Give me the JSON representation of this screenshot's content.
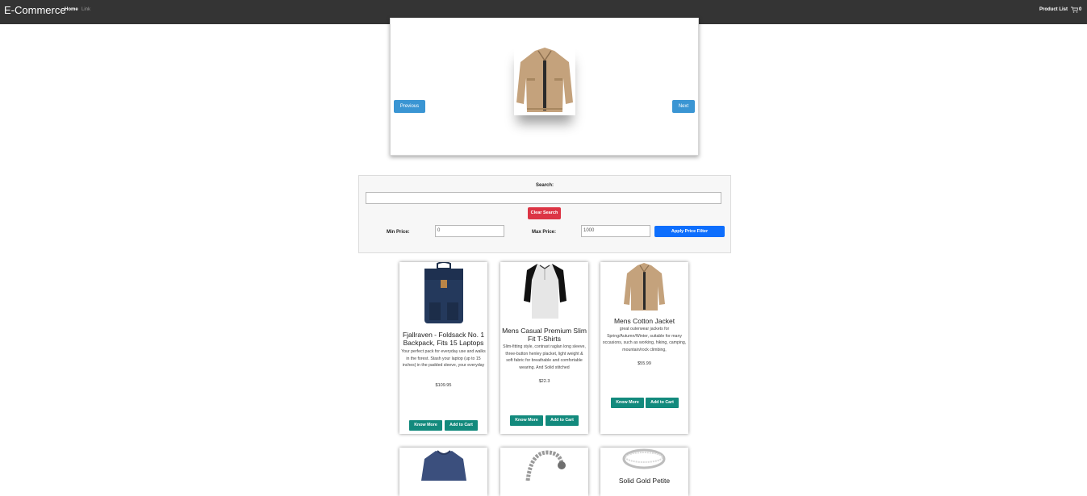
{
  "navbar": {
    "brand": "E-Commerce",
    "home": "Home",
    "link": "Link",
    "product_list": "Product List",
    "cart_count": "0"
  },
  "carousel": {
    "previous": "Previous",
    "next": "Next"
  },
  "filter": {
    "search_label": "Search:",
    "search_value": "",
    "clear_label": "Clear Search",
    "min_label": "Min Price:",
    "min_value": "0",
    "max_label": "Max Price:",
    "max_value": "1000",
    "apply_label": "Apply Price Filter"
  },
  "products": [
    {
      "title": "Fjallraven - Foldsack No. 1 Backpack, Fits 15 Laptops",
      "description": "Your perfect pack for everyday use and walks in the forest. Stash your laptop (up to 15 inches) in the padded sleeve, your everyday",
      "price": "$109.95",
      "know_more": "Know More",
      "add_to_cart": "Add to Cart"
    },
    {
      "title": "Mens Casual Premium Slim Fit T-Shirts",
      "description": "Slim-fitting style, contrast raglan long sleeve, three-button henley placket, light weight & soft fabric for breathable and comfortable wearing. And Solid stitched",
      "price": "$22.3",
      "know_more": "Know More",
      "add_to_cart": "Add to Cart"
    },
    {
      "title": "Mens Cotton Jacket",
      "description": "great outerwear jackets for Spring/Autumn/Winter, suitable for many occasions, such as working, hiking, camping, mountain/rock climbing,",
      "price": "$55.99",
      "know_more": "Know More",
      "add_to_cart": "Add to Cart"
    },
    {
      "title": ""
    },
    {
      "title": ""
    },
    {
      "title": "Solid Gold Petite"
    }
  ],
  "colors": {
    "navbar": "#343434",
    "carousel_button": "#3a95d3",
    "clear_button": "#dc3545",
    "apply_button": "#0d6efd",
    "card_button": "#138a7d"
  }
}
